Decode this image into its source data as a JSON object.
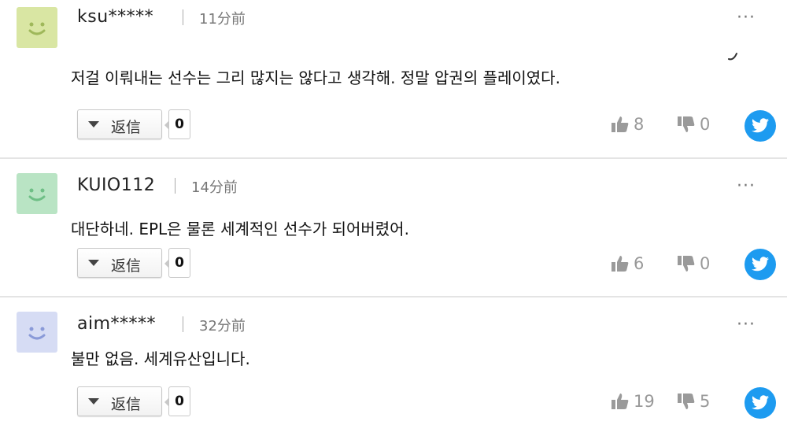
{
  "comments": [
    {
      "username": "ksu*****",
      "time": "11分前",
      "text": "저걸 이뤄내는 선수는 그리 많지는 않다고 생각해. 정말 압권의 플레이였다.",
      "reply_label": "返信",
      "reply_count": "0",
      "likes": "8",
      "dislikes": "0",
      "avatar_color": "#d9e6a3",
      "avatar_face_color": "#9fb85a",
      "more_label": "···"
    },
    {
      "username": "KUIO112",
      "time": "14分前",
      "text": "대단하네. EPL은 물론 세계적인 선수가 되어버렸어.",
      "reply_label": "返信",
      "reply_count": "0",
      "likes": "6",
      "dislikes": "0",
      "avatar_color": "#b9e4c4",
      "avatar_face_color": "#6fbf86",
      "more_label": "···"
    },
    {
      "username": "aim*****",
      "time": "32分前",
      "text": "불만 없음. 세계유산입니다.",
      "reply_label": "返信",
      "reply_count": "0",
      "likes": "19",
      "dislikes": "5",
      "avatar_color": "#d6dcf4",
      "avatar_face_color": "#8a9ad8",
      "more_label": "···"
    }
  ],
  "colors": {
    "twitter": "#1d9bf0",
    "divider": "#e4e4e4",
    "vote_icon": "#9a9a9a"
  },
  "icons": {
    "reply_toggle": "triangle-down-icon",
    "like": "thumbs-up-icon",
    "dislike": "thumbs-down-icon",
    "share": "twitter-icon",
    "more": "more-dots-icon"
  }
}
